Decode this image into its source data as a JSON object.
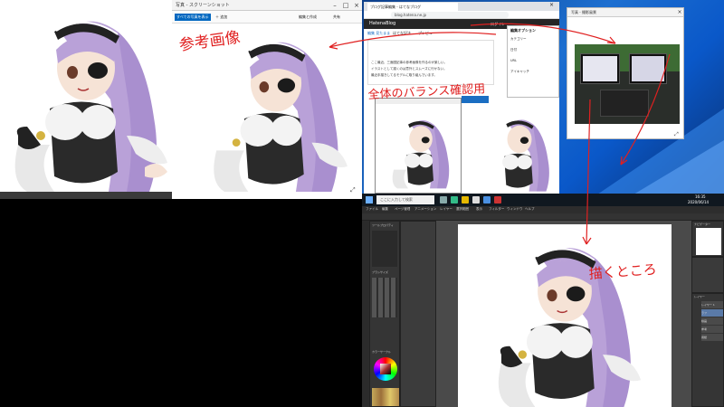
{
  "annotations": {
    "reference_label": "参考画像",
    "overall_balance_label": "全体のバランス確認用",
    "drawing_label": "描くところ"
  },
  "viewer_window": {
    "title": "写真 - スクリーンショット",
    "toolbar_button": "すべての写真を表示",
    "add_label": "＋ 追加",
    "edit_label": "編集と作成",
    "share_label": "共有"
  },
  "browser_window": {
    "tab_label": "ブログ記事編集 - はてなブログ",
    "url": "blog.hatena.ne.jp",
    "site_title": "HatenaBlog",
    "edit_tabs": [
      "編集 見たまま",
      "はてな記法",
      "プレビュー"
    ],
    "body_lines": [
      "ここ最近、三面図記事の参考画像を作るのが楽しい。",
      "イラストとして描くのは意外とスムーズに行かない。",
      "最近手描きしてるモデルに取り組んでいます。"
    ],
    "popup_title": "編集オプション",
    "popup_lines": [
      "カテゴリー",
      "日付",
      "URL",
      "アイキャッチ"
    ],
    "section_label": "見たまま編集",
    "user_label": "ログイン"
  },
  "photo_window": {
    "title": "写真 - 撮影風景"
  },
  "taskbar": {
    "search_placeholder": "ここに入力して検索",
    "time": "16:35",
    "date": "2020/06/14"
  },
  "paint_app": {
    "menu": [
      "ファイル",
      "編集",
      "ページ管理",
      "アニメーション",
      "レイヤー",
      "選択範囲",
      "表示",
      "フィルター",
      "ウィンドウ",
      "ヘルプ"
    ],
    "tool_property_title": "ツールプロパティ",
    "brush_title": "ブラシサイズ",
    "color_title": "カラーサークル",
    "layer_title": "レイヤー",
    "layer_names": [
      "レイヤー 1",
      "ラフ",
      "線画",
      "参考",
      "用紙"
    ],
    "navigator_title": "ナビゲーター"
  },
  "colors": {
    "desktop_blue": "#1d6fd0",
    "paint_dark": "#3a3a3a",
    "annotation_red": "#e02020",
    "hair_lavender": "#b9a1d8"
  }
}
